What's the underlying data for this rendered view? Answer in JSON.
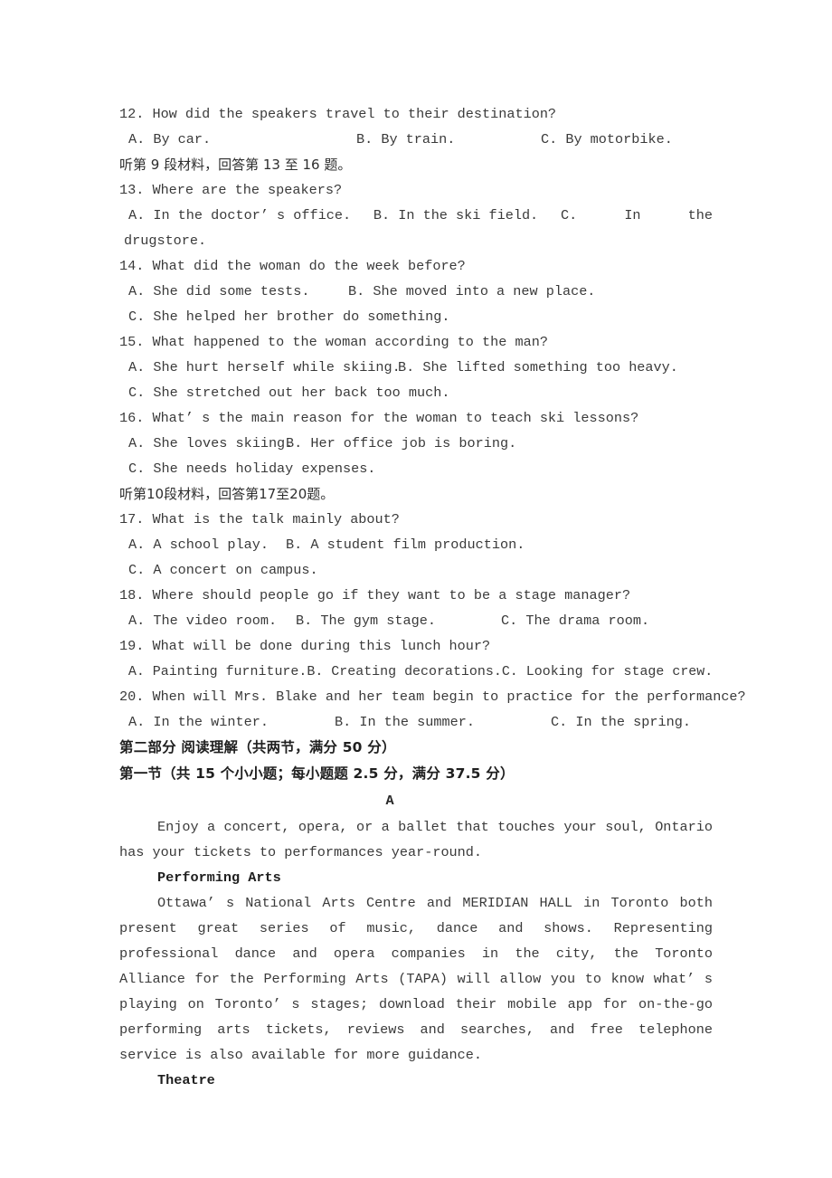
{
  "document": {
    "type": "exam-paper",
    "language": "zh-CN / en",
    "text_color": "#3a3a3a",
    "background_color": "#ffffff"
  },
  "listening": {
    "questions": [
      {
        "number": "12.",
        "stem": "12. How did the speakers travel to their destination?",
        "options": {
          "a": "A. By car.",
          "b": "B. By train.",
          "c": "C. By motorbike."
        }
      },
      {
        "number": "13.",
        "stem": "13. Where are the speakers?",
        "options": {
          "a": "A. In the doctor’ s office.",
          "b": "B. In the ski field.",
          "c_label": "C.",
          "c_word1": "In",
          "c_word2": "the",
          "c_continuation": "drugstore."
        }
      },
      {
        "number": "14.",
        "stem": "14. What did the woman do the week before?",
        "options": {
          "a": "A. She did some tests.",
          "b": "B. She moved into a new place.",
          "c": "C. She helped her brother do something."
        }
      },
      {
        "number": "15.",
        "stem": "15. What happened to the woman according to the man?",
        "options": {
          "a": "A. She hurt herself while skiing.",
          "b": "B. She lifted something too heavy.",
          "c": "C. She stretched out her back too much."
        }
      },
      {
        "number": "16.",
        "stem": "16. What’ s the main reason for the woman to teach ski lessons?",
        "options": {
          "a": "A. She loves skiing.",
          "b": "B. Her office job is boring.",
          "c": "C. She needs holiday expenses."
        }
      },
      {
        "number": "17.",
        "stem": "17. What is the talk mainly about?",
        "options": {
          "a": "A. A school play.",
          "b": "B. A student film production.",
          "c": "C. A concert on campus."
        }
      },
      {
        "number": "18.",
        "stem": "18. Where should people go if they want to be a stage manager?",
        "options": {
          "a": "A. The video room.",
          "b": "B. The gym stage.",
          "c": "C. The drama room."
        }
      },
      {
        "number": "19.",
        "stem": "19. What will be done during this lunch hour?",
        "options": {
          "a": "A. Painting furniture.",
          "b": "B. Creating decorations.",
          "c": "C. Looking for stage crew."
        }
      },
      {
        "number": "20.",
        "stem": "20. When will Mrs. Blake and her team begin to practice for the performance?",
        "options": {
          "a": "A. In the winter.",
          "b": "B. In the summer.",
          "c": "C. In the spring."
        }
      }
    ],
    "instruction_set9": "听第 9 段材料，回答第 13 至 16 题。",
    "instruction_set10": "听第10段材料，回答第17至20题。"
  },
  "reading": {
    "part_heading": "第二部分 阅读理解（共两节，满分 50 分）",
    "section_heading": "第一节（共 15 个小小题；每小题题 2.5 分，满分 37.5 分）",
    "passage_letter": "A",
    "passage": {
      "intro": "Enjoy a concert, opera, or a ballet that touches your soul, Ontario has your tickets to performances year-round.",
      "heading_performing_arts": "Performing Arts",
      "body_performing_arts": "Ottawa’ s National Arts Centre and MERIDIAN HALL in Toronto both present great series of music, dance and shows. Representing professional dance and opera companies in the city, the Toronto Alliance for the Performing Arts (TAPA) will allow you to know what’ s playing on Toronto’ s stages; download their mobile app for on-the-go performing arts tickets, reviews and searches, and free telephone service is also available for more guidance.",
      "heading_theatre": "Theatre"
    }
  }
}
